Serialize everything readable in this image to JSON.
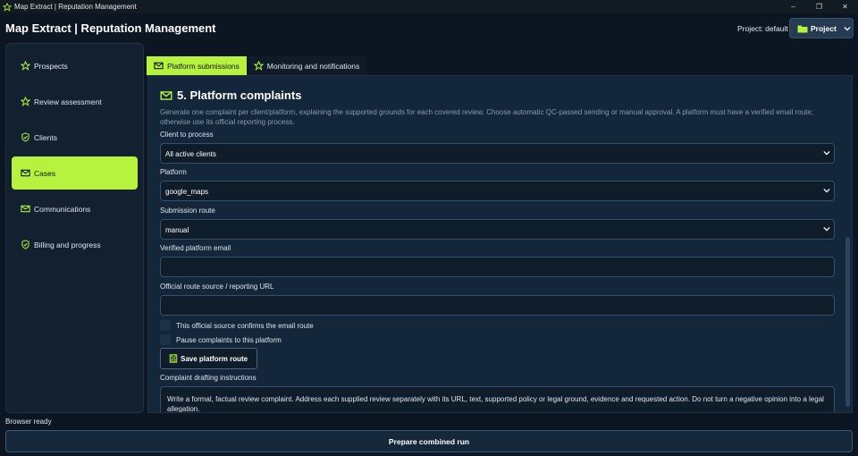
{
  "window": {
    "title": "Map Extract | Reputation Management",
    "controls": {
      "minimize": "–",
      "maximize": "❐",
      "close": "✕"
    }
  },
  "header": {
    "title": "Map Extract | Reputation Management",
    "project_label": "Project: default",
    "project_button": "Project"
  },
  "sidebar": {
    "items": [
      {
        "label": "Prospects",
        "icon": "star-icon"
      },
      {
        "label": "Review assessment",
        "icon": "star-icon"
      },
      {
        "label": "Clients",
        "icon": "shield-check-icon"
      },
      {
        "label": "Cases",
        "icon": "envelope-icon",
        "active": true
      },
      {
        "label": "Communications",
        "icon": "envelope-icon"
      },
      {
        "label": "Billing and progress",
        "icon": "shield-check-icon"
      }
    ]
  },
  "tabs": [
    {
      "label": "Platform submissions",
      "icon": "envelope-icon",
      "active": true
    },
    {
      "label": "Monitoring and notifications",
      "icon": "star-icon",
      "active": false
    }
  ],
  "section": {
    "title": "5. Platform complaints",
    "description": "Generate one complaint per client/platform, explaining the supported grounds for each covered review. Choose automatic QC-passed sending or manual approval. A platform must have a verified email route; otherwise use its official reporting process.",
    "client_label": "Client to process",
    "client_value": "All active clients",
    "platform_label": "Platform",
    "platform_value": "google_maps",
    "route_label": "Submission route",
    "route_value": "manual",
    "email_label": "Verified platform email",
    "email_value": "",
    "source_label": "Official route source / reporting URL",
    "source_value": "",
    "confirm_checkbox": "This official source confirms the email route",
    "pause_checkbox": "Pause complaints to this platform",
    "save_button": "Save platform route",
    "instructions_label": "Complaint drafting instructions",
    "instructions_text": "Write a formal, factual review complaint. Address each supplied review separately with its URL, text, supported policy or legal ground, evidence and requested action. Do not turn a negative opinion into a legal allegation."
  },
  "footer": {
    "status": "Browser ready",
    "run_button": "Prepare combined run"
  },
  "colors": {
    "background": "#0b1622",
    "accent": "#b7f23f",
    "panel": "#13263a"
  }
}
